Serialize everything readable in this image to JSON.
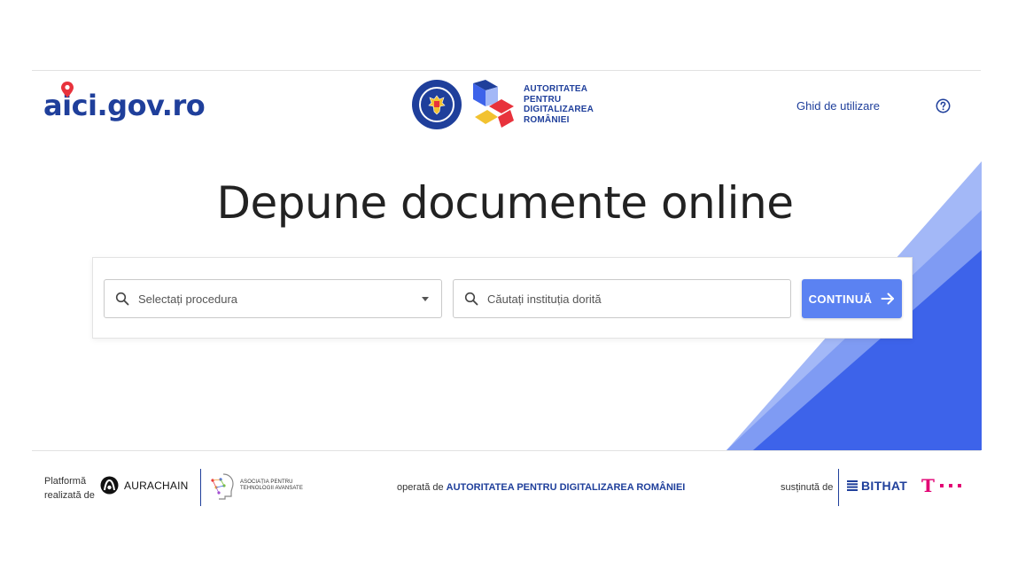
{
  "header": {
    "logo_text": "aici.gov.ro",
    "gov_seal_label": "GUVERNUL ROMÂNIEI",
    "adr_lines": [
      "AUTORITATEA",
      "PENTRU",
      "DIGITALIZAREA",
      "ROMÂNIEI"
    ],
    "guide_link": "Ghid de utilizare",
    "help_icon": "question-circle-icon"
  },
  "hero": {
    "title": "Depune documente online"
  },
  "search": {
    "procedure_placeholder": "Selectați procedura",
    "institution_placeholder": "Căutați instituția dorită",
    "continue_label": "CONTINUĂ",
    "search_icon": "search-icon",
    "arrow_icon": "arrow-right-icon"
  },
  "footer": {
    "platform_lines": [
      "Platformă",
      "realizată de"
    ],
    "aurachain_label": "AURACHAIN",
    "apta_lines": [
      "ASOCIAȚIA PENTRU",
      "TEHNOLOGII AVANSATE"
    ],
    "operated_prefix": "operată de",
    "operated_org": "AUTORITATEA PENTRU DIGITALIZAREA ROMÂNIEI",
    "supported_label": "susținută de",
    "bithat_label": "BITHAT",
    "telekom_label": "T"
  },
  "colors": {
    "brand_blue": "#1f3f9b",
    "button_blue": "#5b82f2",
    "logo_red": "#e8323c",
    "deco_blue_light": "#a3b8f7",
    "deco_blue": "#3d63ea",
    "telekom_magenta": "#e20074"
  }
}
